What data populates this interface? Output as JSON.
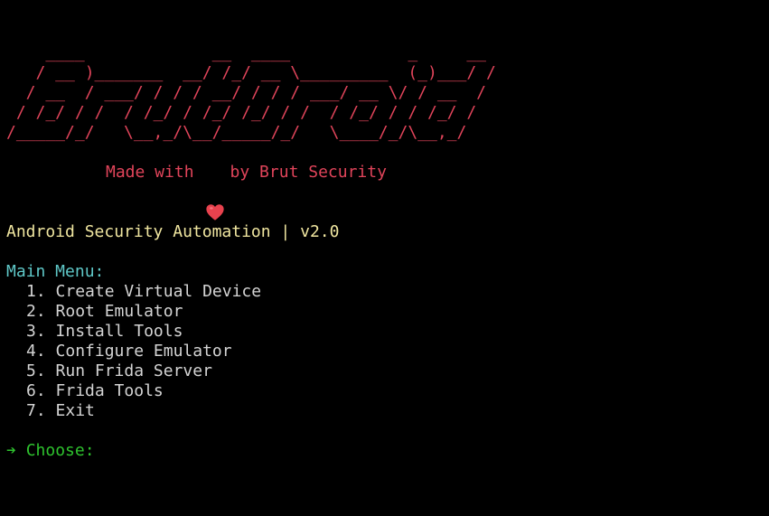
{
  "colors": {
    "background": "#000000",
    "banner": "#e0445a",
    "tagline": "#e0445a",
    "heart": "#e8424e",
    "subtitle": "#f0e6a0",
    "menu_title": "#5fc8c8",
    "menu_item": "#d4d4d4",
    "prompt": "#2ec22e"
  },
  "banner": {
    "lines": [
      "    ____             __  ____            _     __",
      "   / __ )_______  __/ /_/ __ \\_________  (_)___/ /",
      "  / __  / ___/ / / / __/ / / / ___/ __ \\/ / __  / ",
      " / /_/ / /  / /_/ / /_/ /_/ / /  / /_/ / / /_/ /  ",
      "/_____/_/   \\__,_/\\__/_____/_/   \\____/_/\\__,_/   "
    ]
  },
  "tagline": {
    "prefix": "Made with",
    "suffix": "by Brut Security",
    "icon": "heart-icon"
  },
  "subtitle": "Android Security Automation | v2.0",
  "menu": {
    "title": "Main Menu:",
    "items": [
      {
        "number": "1.",
        "label": "Create Virtual Device"
      },
      {
        "number": "2.",
        "label": "Root Emulator"
      },
      {
        "number": "3.",
        "label": "Install Tools"
      },
      {
        "number": "4.",
        "label": "Configure Emulator"
      },
      {
        "number": "5.",
        "label": "Run Frida Server"
      },
      {
        "number": "6.",
        "label": "Frida Tools"
      },
      {
        "number": "7.",
        "label": "Exit"
      }
    ]
  },
  "prompt": {
    "arrow": "➔",
    "label": "Choose:",
    "value": ""
  }
}
